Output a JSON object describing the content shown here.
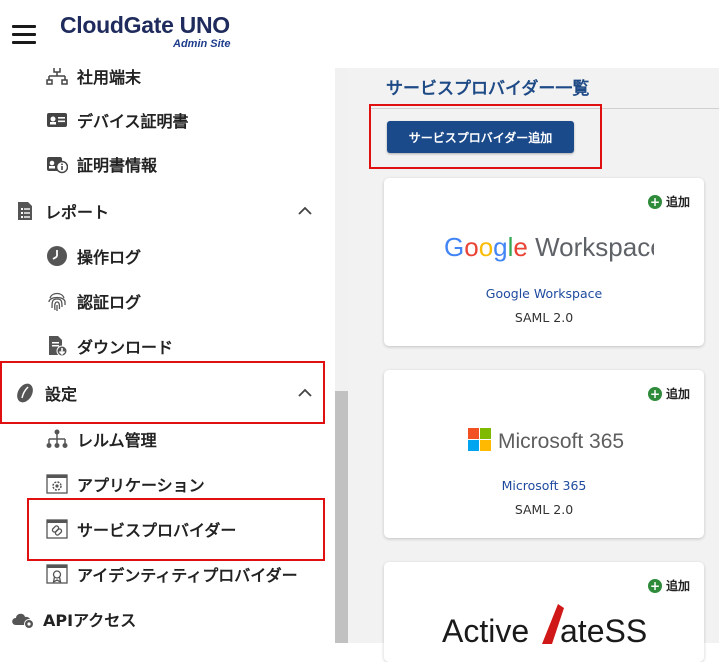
{
  "header": {
    "logo": "CloudGate UNO",
    "logo_sub": "Admin Site"
  },
  "sidebar": {
    "items": [
      {
        "label": "社用端末",
        "icon": "network-tree-icon"
      },
      {
        "label": "デバイス証明書",
        "icon": "id-card-icon"
      },
      {
        "label": "証明書情報",
        "icon": "certificate-info-icon"
      },
      {
        "label": "レポート",
        "icon": "report-icon",
        "expanded": true
      },
      {
        "label": "操作ログ",
        "icon": "clock-icon"
      },
      {
        "label": "認証ログ",
        "icon": "fingerprint-icon"
      },
      {
        "label": "ダウンロード",
        "icon": "download-file-icon"
      },
      {
        "label": "設定",
        "icon": "settings-leaf-icon",
        "expanded": true
      },
      {
        "label": "レルム管理",
        "icon": "hierarchy-icon"
      },
      {
        "label": "アプリケーション",
        "icon": "app-gear-icon"
      },
      {
        "label": "サービスプロバイダー",
        "icon": "link-window-icon"
      },
      {
        "label": "アイデンティティプロバイダー",
        "icon": "certificate-window-icon"
      },
      {
        "label": "APIアクセス",
        "icon": "cloud-gear-icon"
      }
    ]
  },
  "main": {
    "title": "サービスプロバイダー一覧",
    "add_button": "サービスプロバイダー追加",
    "cards": [
      {
        "add_label": "追加",
        "name": "Google Workspace",
        "protocol": "SAML 2.0",
        "logo": "Google Workspace"
      },
      {
        "add_label": "追加",
        "name": "Microsoft 365",
        "protocol": "SAML 2.0",
        "logo": "Microsoft 365"
      },
      {
        "add_label": "追加",
        "logo": "ActiveGateSS"
      }
    ]
  },
  "colors": {
    "accent": "#1b4a8b",
    "highlight": "#e01010",
    "add_green": "#2e8b3a"
  }
}
